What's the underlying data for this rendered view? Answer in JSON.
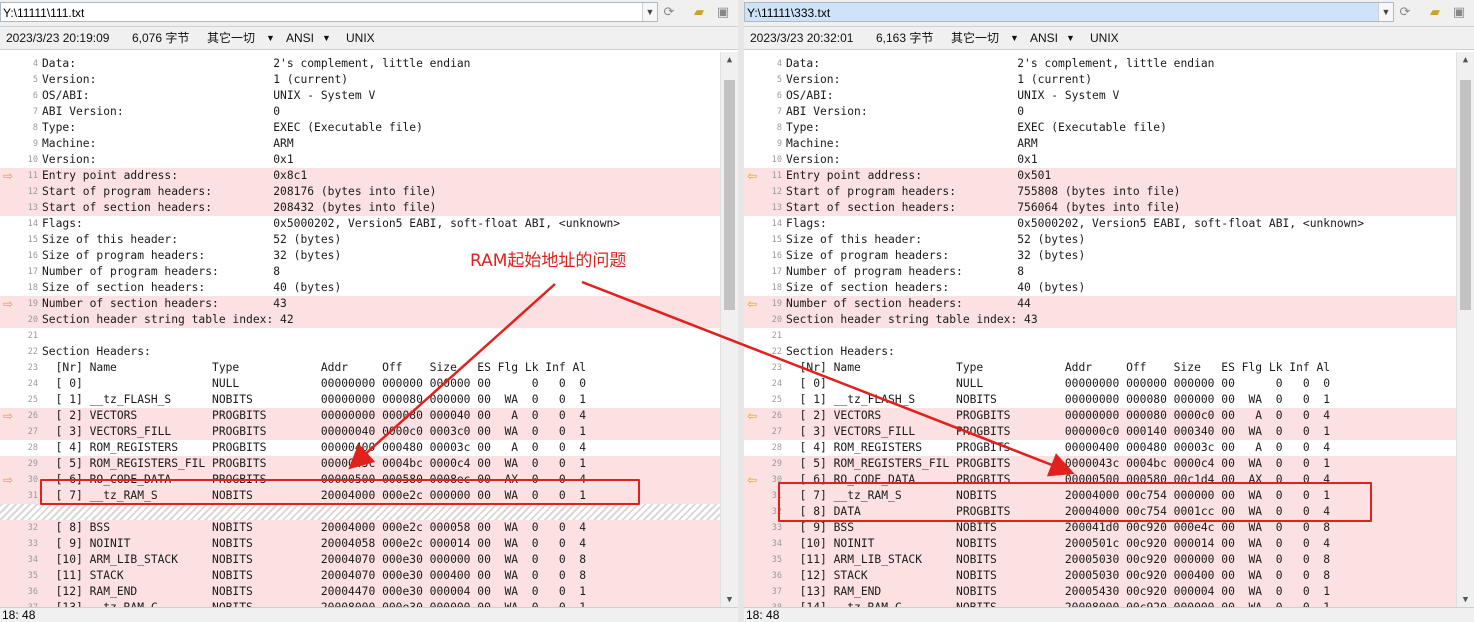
{
  "annotation": "RAM起始地址的问题",
  "left": {
    "path": "Y:\\11111\\111.txt",
    "date": "2023/3/23 20:19:09",
    "size": "6,076 字节",
    "mode": "其它一切",
    "encoding": "ANSI",
    "eol": "UNIX",
    "status": "18: 48",
    "rows": [
      {
        "n": "4",
        "t": "Data:                             2's complement, little endian"
      },
      {
        "n": "5",
        "t": "Version:                          1 (current)"
      },
      {
        "n": "6",
        "t": "OS/ABI:                           UNIX - System V"
      },
      {
        "n": "7",
        "t": "ABI Version:                      0"
      },
      {
        "n": "8",
        "t": "Type:                             EXEC (Executable file)"
      },
      {
        "n": "9",
        "t": "Machine:                          ARM"
      },
      {
        "n": "10",
        "t": "Version:                          0x1"
      },
      {
        "n": "11",
        "t": "Entry point address:              0x8c1"
      },
      {
        "n": "12",
        "t": "Start of program headers:         208176 (bytes into file)"
      },
      {
        "n": "13",
        "t": "Start of section headers:         208432 (bytes into file)"
      },
      {
        "n": "14",
        "t": "Flags:                            0x5000202, Version5 EABI, soft-float ABI, <unknown>"
      },
      {
        "n": "15",
        "t": "Size of this header:              52 (bytes)"
      },
      {
        "n": "16",
        "t": "Size of program headers:          32 (bytes)"
      },
      {
        "n": "17",
        "t": "Number of program headers:        8"
      },
      {
        "n": "18",
        "t": "Size of section headers:          40 (bytes)"
      },
      {
        "n": "19",
        "t": "Number of section headers:        43"
      },
      {
        "n": "20",
        "t": "Section header string table index: 42"
      },
      {
        "n": "21",
        "t": ""
      },
      {
        "n": "22",
        "t": "Section Headers:"
      },
      {
        "n": "23",
        "t": "  [Nr] Name              Type            Addr     Off    Size   ES Flg Lk Inf Al"
      },
      {
        "n": "24",
        "t": "  [ 0]                   NULL            00000000 000000 000000 00      0   0  0"
      },
      {
        "n": "25",
        "t": "  [ 1] __tz_FLASH_S      NOBITS          00000000 000080 000000 00  WA  0   0  1"
      },
      {
        "n": "26",
        "t": "  [ 2] VECTORS           PROGBITS        00000000 000080 000040 00   A  0   0  4"
      },
      {
        "n": "27",
        "t": "  [ 3] VECTORS_FILL      PROGBITS        00000040 0000c0 0003c0 00  WA  0   0  1"
      },
      {
        "n": "28",
        "t": "  [ 4] ROM_REGISTERS     PROGBITS        00000400 000480 00003c 00   A  0   0  4"
      },
      {
        "n": "29",
        "t": "  [ 5] ROM_REGISTERS_FIL PROGBITS        0000043c 0004bc 0000c4 00  WA  0   0  1"
      },
      {
        "n": "30",
        "t": "  [ 6] RO_CODE_DATA      PROGBITS        00000500 000580 0008ec 00  AX  0   0  4"
      },
      {
        "n": "31",
        "t": "  [ 7] __tz_RAM_S        NOBITS          20004000 000e2c 000000 00  WA  0   0  1"
      },
      {
        "n": "",
        "t": ""
      },
      {
        "n": "32",
        "t": "  [ 8] BSS               NOBITS          20004000 000e2c 000058 00  WA  0   0  4"
      },
      {
        "n": "33",
        "t": "  [ 9] NOINIT            NOBITS          20004058 000e2c 000014 00  WA  0   0  4"
      },
      {
        "n": "34",
        "t": "  [10] ARM_LIB_STACK     NOBITS          20004070 000e30 000000 00  WA  0   0  8"
      },
      {
        "n": "35",
        "t": "  [11] STACK             NOBITS          20004070 000e30 000400 00  WA  0   0  8"
      },
      {
        "n": "36",
        "t": "  [12] RAM_END           NOBITS          20004470 000e30 000004 00  WA  0   0  1"
      },
      {
        "n": "37",
        "t": "  [13] __tz_RAM_C        NOBITS          20008000 000e30 000000 00  WA  0   0  1"
      }
    ]
  },
  "right": {
    "path": "Y:\\11111\\333.txt",
    "date": "2023/3/23 20:32:01",
    "size": "6,163 字节",
    "mode": "其它一切",
    "encoding": "ANSI",
    "eol": "UNIX",
    "status": "18: 48",
    "rows": [
      {
        "n": "4",
        "t": "Data:                             2's complement, little endian"
      },
      {
        "n": "5",
        "t": "Version:                          1 (current)"
      },
      {
        "n": "6",
        "t": "OS/ABI:                           UNIX - System V"
      },
      {
        "n": "7",
        "t": "ABI Version:                      0"
      },
      {
        "n": "8",
        "t": "Type:                             EXEC (Executable file)"
      },
      {
        "n": "9",
        "t": "Machine:                          ARM"
      },
      {
        "n": "10",
        "t": "Version:                          0x1"
      },
      {
        "n": "11",
        "t": "Entry point address:              0x501"
      },
      {
        "n": "12",
        "t": "Start of program headers:         755808 (bytes into file)"
      },
      {
        "n": "13",
        "t": "Start of section headers:         756064 (bytes into file)"
      },
      {
        "n": "14",
        "t": "Flags:                            0x5000202, Version5 EABI, soft-float ABI, <unknown>"
      },
      {
        "n": "15",
        "t": "Size of this header:              52 (bytes)"
      },
      {
        "n": "16",
        "t": "Size of program headers:          32 (bytes)"
      },
      {
        "n": "17",
        "t": "Number of program headers:        8"
      },
      {
        "n": "18",
        "t": "Size of section headers:          40 (bytes)"
      },
      {
        "n": "19",
        "t": "Number of section headers:        44"
      },
      {
        "n": "20",
        "t": "Section header string table index: 43"
      },
      {
        "n": "21",
        "t": ""
      },
      {
        "n": "22",
        "t": "Section Headers:"
      },
      {
        "n": "23",
        "t": "  [Nr] Name              Type            Addr     Off    Size   ES Flg Lk Inf Al"
      },
      {
        "n": "24",
        "t": "  [ 0]                   NULL            00000000 000000 000000 00      0   0  0"
      },
      {
        "n": "25",
        "t": "  [ 1] __tz_FLASH_S      NOBITS          00000000 000080 000000 00  WA  0   0  1"
      },
      {
        "n": "26",
        "t": "  [ 2] VECTORS           PROGBITS        00000000 000080 0000c0 00   A  0   0  4"
      },
      {
        "n": "27",
        "t": "  [ 3] VECTORS_FILL      PROGBITS        000000c0 000140 000340 00  WA  0   0  1"
      },
      {
        "n": "28",
        "t": "  [ 4] ROM_REGISTERS     PROGBITS        00000400 000480 00003c 00   A  0   0  4"
      },
      {
        "n": "29",
        "t": "  [ 5] ROM_REGISTERS_FIL PROGBITS        0000043c 0004bc 0000c4 00  WA  0   0  1"
      },
      {
        "n": "30",
        "t": "  [ 6] RO_CODE_DATA      PROGBITS        00000500 000580 00c1d4 00  AX  0   0  4"
      },
      {
        "n": "31",
        "t": "  [ 7] __tz_RAM_S        NOBITS          20004000 00c754 000000 00  WA  0   0  1"
      },
      {
        "n": "32",
        "t": "  [ 8] DATA              PROGBITS        20004000 00c754 0001cc 00  WA  0   0  4"
      },
      {
        "n": "33",
        "t": "  [ 9] BSS               NOBITS          200041d0 00c920 000e4c 00  WA  0   0  8"
      },
      {
        "n": "34",
        "t": "  [10] NOINIT            NOBITS          2000501c 00c920 000014 00  WA  0   0  4"
      },
      {
        "n": "35",
        "t": "  [11] ARM_LIB_STACK     NOBITS          20005030 00c920 000000 00  WA  0   0  8"
      },
      {
        "n": "36",
        "t": "  [12] STACK             NOBITS          20005030 00c920 000400 00  WA  0   0  8"
      },
      {
        "n": "37",
        "t": "  [13] RAM_END           NOBITS          20005430 00c920 000004 00  WA  0   0  1"
      },
      {
        "n": "38",
        "t": "  [14] __tz_RAM_C        NOBITS          20008000 00c920 000000 00  WA  0   0  1"
      }
    ]
  },
  "icons": {
    "dropdown": "chevron-down-icon",
    "sync": "sync-icon",
    "folder": "folder-open-icon",
    "save": "save-icon",
    "marker": "arrow-right-icon"
  },
  "colors": {
    "diff_bg": "#fbe1e1",
    "annotation_red": "#e0211d",
    "marker": "#e0a020"
  }
}
